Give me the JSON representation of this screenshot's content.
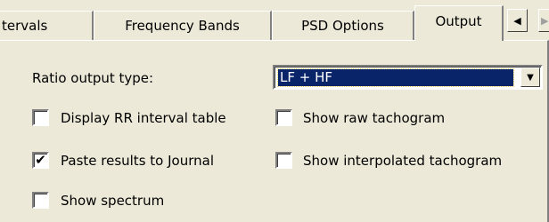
{
  "tabs": [
    {
      "label": "tervals"
    },
    {
      "label": "Frequency Bands"
    },
    {
      "label": "PSD Options"
    },
    {
      "label": "Output"
    }
  ],
  "scroll_left_icon": "◀",
  "scroll_right_icon": "▶",
  "ratio": {
    "label": "Ratio output type:",
    "value": "LF + HF",
    "dropdown_icon": "▼"
  },
  "options": {
    "display_rr": {
      "label": "Display RR interval table",
      "checked": false
    },
    "show_raw": {
      "label": "Show raw tachogram",
      "checked": false
    },
    "paste_journal": {
      "label": "Paste results to Journal",
      "checked": true
    },
    "show_interpolated": {
      "label": "Show interpolated tachogram",
      "checked": false
    },
    "show_spectrum": {
      "label": "Show spectrum",
      "checked": false
    }
  },
  "check_mark": "✔"
}
